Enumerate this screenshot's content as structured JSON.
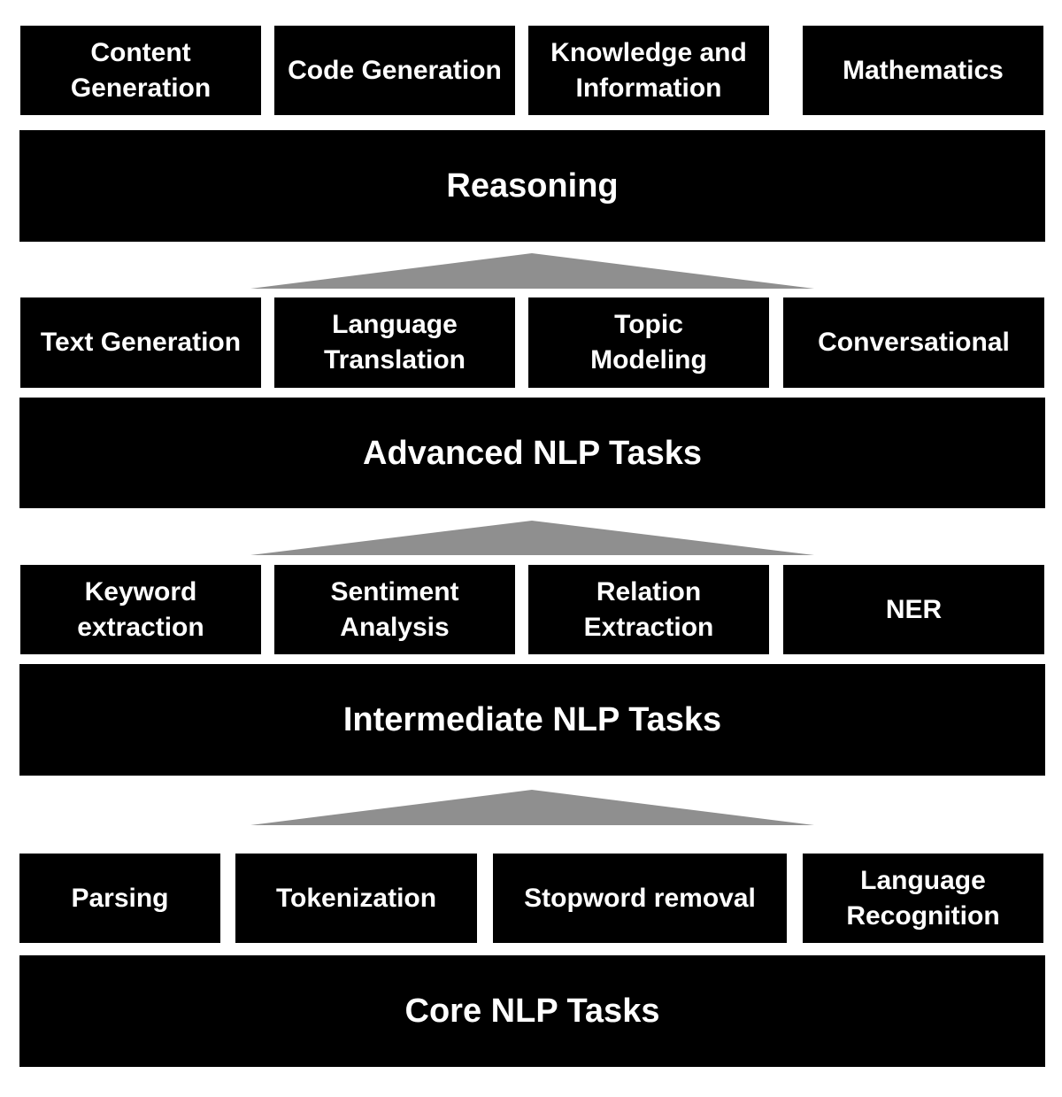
{
  "colors": {
    "box": "#000000",
    "text": "#ffffff",
    "arrow": "#8f8f8f"
  },
  "layers": [
    {
      "name": "Reasoning",
      "tasks": [
        "Content\nGeneration",
        "Code Generation",
        "Knowledge and\nInformation",
        "Mathematics"
      ]
    },
    {
      "name": "Advanced NLP Tasks",
      "tasks": [
        "Text Generation",
        "Language\nTranslation",
        "Topic\nModeling",
        "Conversational"
      ]
    },
    {
      "name": "Intermediate NLP Tasks",
      "tasks": [
        "Keyword\nextraction",
        "Sentiment\nAnalysis",
        "Relation\nExtraction",
        "NER"
      ]
    },
    {
      "name": "Core NLP Tasks",
      "tasks": [
        "Parsing",
        "Tokenization",
        "Stopword removal",
        "Language\nRecognition"
      ]
    }
  ]
}
